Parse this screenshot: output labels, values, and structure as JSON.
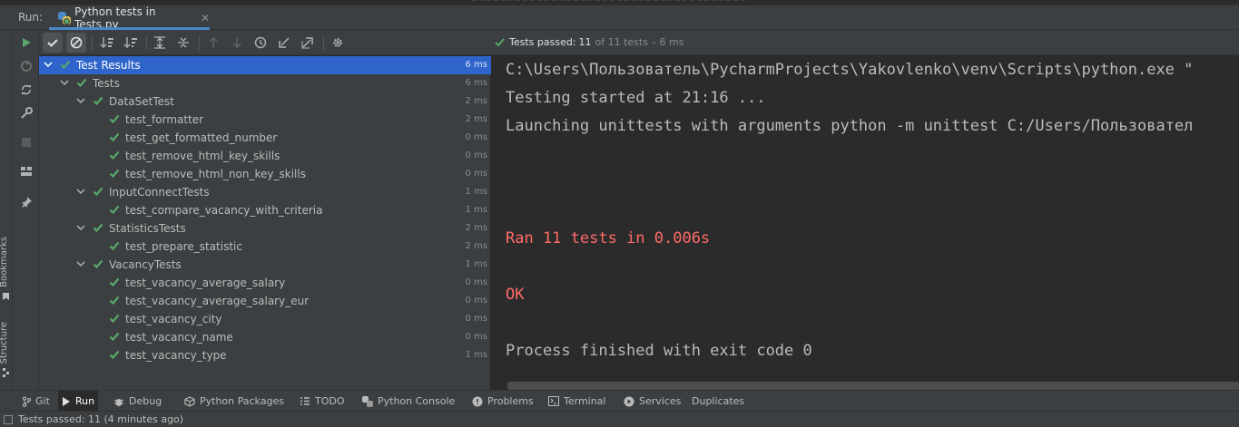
{
  "run_header": {
    "label": "Run:",
    "tab_title": "Python tests in Tests.py",
    "tab_close": "✕"
  },
  "toolbar": {
    "status_passed": "Tests passed:",
    "status_count": "11",
    "status_rest": "of 11 tests – 6 ms"
  },
  "side_labels": {
    "bookmarks": "Bookmarks",
    "structure": "Structure"
  },
  "tree": [
    {
      "name": "Test Results",
      "duration": "6 ms",
      "depth": 0,
      "expanded": true,
      "selected": true
    },
    {
      "name": "Tests",
      "duration": "6 ms",
      "depth": 1,
      "expanded": true
    },
    {
      "name": "DataSetTest",
      "duration": "2 ms",
      "depth": 2,
      "expanded": true
    },
    {
      "name": "test_formatter",
      "duration": "2 ms",
      "depth": 3
    },
    {
      "name": "test_get_formatted_number",
      "duration": "0 ms",
      "depth": 3
    },
    {
      "name": "test_remove_html_key_skills",
      "duration": "0 ms",
      "depth": 3
    },
    {
      "name": "test_remove_html_non_key_skills",
      "duration": "0 ms",
      "depth": 3
    },
    {
      "name": "InputConnectTests",
      "duration": "1 ms",
      "depth": 2,
      "expanded": true
    },
    {
      "name": "test_compare_vacancy_with_criteria",
      "duration": "1 ms",
      "depth": 3
    },
    {
      "name": "StatisticsTests",
      "duration": "2 ms",
      "depth": 2,
      "expanded": true
    },
    {
      "name": "test_prepare_statistic",
      "duration": "2 ms",
      "depth": 3
    },
    {
      "name": "VacancyTests",
      "duration": "1 ms",
      "depth": 2,
      "expanded": true
    },
    {
      "name": "test_vacancy_average_salary",
      "duration": "0 ms",
      "depth": 3
    },
    {
      "name": "test_vacancy_average_salary_eur",
      "duration": "0 ms",
      "depth": 3
    },
    {
      "name": "test_vacancy_city",
      "duration": "0 ms",
      "depth": 3
    },
    {
      "name": "test_vacancy_name",
      "duration": "0 ms",
      "depth": 3
    },
    {
      "name": "test_vacancy_type",
      "duration": "1 ms",
      "depth": 3
    }
  ],
  "console": {
    "lines": [
      {
        "text": "C:\\Users\\Пользователь\\PycharmProjects\\Yakovlenko\\venv\\Scripts\\python.exe \"",
        "style": "normal"
      },
      {
        "text": "Testing started at 21:16 ...",
        "style": "normal"
      },
      {
        "text": "Launching unittests with arguments python -m unittest C:/Users/Пользовател",
        "style": "normal"
      },
      {
        "text": "",
        "style": "normal"
      },
      {
        "text": "",
        "style": "normal"
      },
      {
        "text": "",
        "style": "normal"
      },
      {
        "text": "Ran 11 tests in 0.006s",
        "style": "err"
      },
      {
        "text": "",
        "style": "normal"
      },
      {
        "text": "OK",
        "style": "err"
      },
      {
        "text": "",
        "style": "normal"
      },
      {
        "text": "Process finished with exit code 0",
        "style": "normal"
      }
    ]
  },
  "bottom_tabs": [
    {
      "label": "Git",
      "icon": "git-branch-icon"
    },
    {
      "label": "Run",
      "icon": "run-play-icon",
      "active": true
    },
    {
      "label": "Debug",
      "icon": "debug-bug-icon"
    },
    {
      "label": "Python Packages",
      "icon": "packages-icon"
    },
    {
      "label": "TODO",
      "icon": "todo-list-icon"
    },
    {
      "label": "Python Console",
      "icon": "python-console-icon"
    },
    {
      "label": "Problems",
      "icon": "problems-icon"
    },
    {
      "label": "Terminal",
      "icon": "terminal-icon"
    },
    {
      "label": "Services",
      "icon": "services-icon"
    },
    {
      "label": "Duplicates",
      "icon": ""
    }
  ],
  "status_bar": {
    "text": "Tests passed: 11 (4 minutes ago)"
  },
  "colors": {
    "pass_green": "#59a869",
    "error_red": "#ff6b68",
    "selection_blue": "#2f65ca",
    "accent_blue": "#4a88c7"
  }
}
